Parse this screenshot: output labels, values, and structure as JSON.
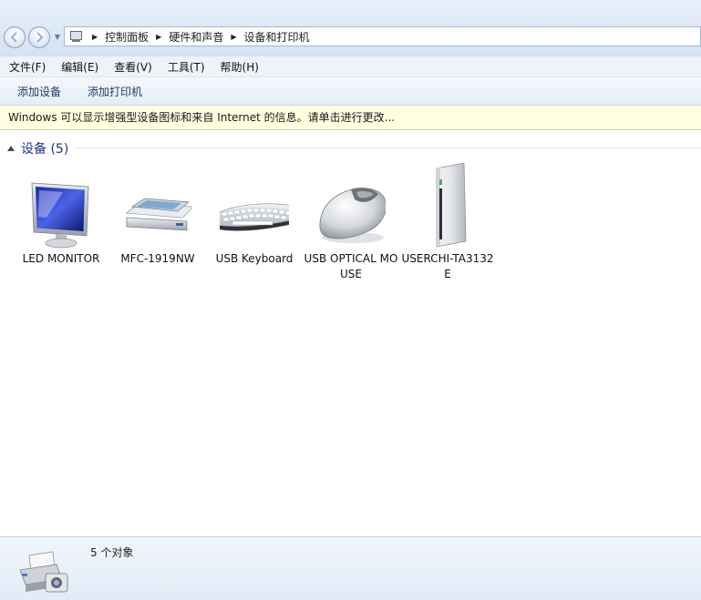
{
  "address": {
    "crumbs": [
      "控制面板",
      "硬件和声音",
      "设备和打印机"
    ]
  },
  "menu": {
    "items": [
      "文件(F)",
      "编辑(E)",
      "查看(V)",
      "工具(T)",
      "帮助(H)"
    ]
  },
  "commands": {
    "add_device": "添加设备",
    "add_printer": "添加打印机"
  },
  "infobar": {
    "text": "Windows 可以显示增强型设备图标和来自 Internet 的信息。请单击进行更改..."
  },
  "group": {
    "title": "设备 (5)"
  },
  "devices": [
    {
      "label": "LED MONITOR",
      "icon": "monitor-icon"
    },
    {
      "label": "MFC-1919NW",
      "icon": "scanner-icon"
    },
    {
      "label": "USB Keyboard",
      "icon": "keyboard-icon"
    },
    {
      "label": "USB OPTICAL MOUSE",
      "icon": "mouse-icon"
    },
    {
      "label": "USERCHI-TA3132E",
      "icon": "external-drive-icon"
    }
  ],
  "status": {
    "text": "5 个对象",
    "icon": "devices-and-printers-icon"
  },
  "colors": {
    "group_title": "#1e3287",
    "infobar_bg": "#ffffe1"
  }
}
